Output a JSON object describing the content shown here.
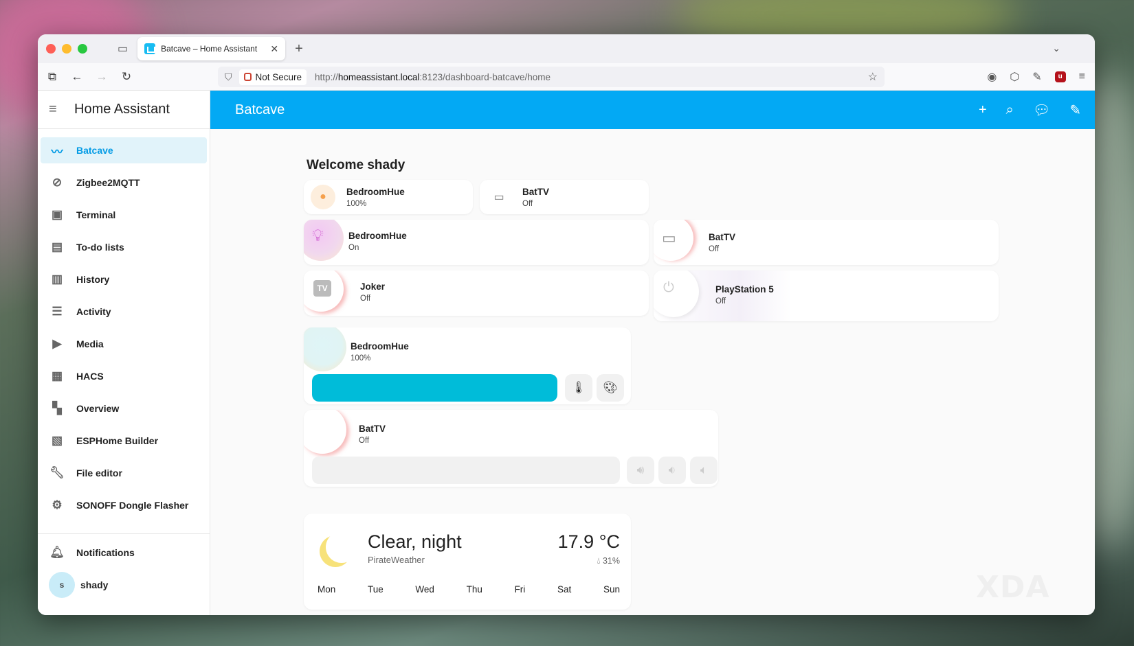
{
  "browser": {
    "tab_title": "Batcave – Home Assistant",
    "address_not_secure": "Not Secure",
    "url_prefix": "http://",
    "url_host": "homeassistant.local",
    "url_path": ":8123/dashboard-batcave/home"
  },
  "sidebar": {
    "app_name": "Home Assistant",
    "items": [
      {
        "label": "Batcave",
        "icon": "bat-icon"
      },
      {
        "label": "Zigbee2MQTT",
        "icon": "zigbee-icon"
      },
      {
        "label": "Terminal",
        "icon": "terminal-icon"
      },
      {
        "label": "To-do lists",
        "icon": "clipboard-list-icon"
      },
      {
        "label": "History",
        "icon": "chart-bar-icon"
      },
      {
        "label": "Activity",
        "icon": "format-list-icon"
      },
      {
        "label": "Media",
        "icon": "play-box-icon"
      },
      {
        "label": "HACS",
        "icon": "hacs-store-icon"
      },
      {
        "label": "Overview",
        "icon": "view-dashboard-icon"
      },
      {
        "label": "ESPHome Builder",
        "icon": "chip-icon"
      },
      {
        "label": "File editor",
        "icon": "wrench-icon"
      },
      {
        "label": "SONOFF Dongle Flasher",
        "icon": "cog-chip-icon"
      }
    ],
    "notifications": "Notifications",
    "user": {
      "initial": "s",
      "name": "shady"
    }
  },
  "header": {
    "title": "Batcave"
  },
  "dashboard": {
    "welcome": "Welcome shady",
    "tiles": [
      {
        "name": "BedroomHue",
        "state": "100%"
      },
      {
        "name": "BatTV",
        "state": "Off"
      }
    ],
    "mushroom": [
      {
        "name": "BedroomHue",
        "state": "On"
      },
      {
        "name": "BatTV",
        "state": "Off"
      },
      {
        "name": "Joker",
        "state": "Off"
      },
      {
        "name": "PlayStation 5",
        "state": "Off"
      }
    ],
    "light_card": {
      "name": "BedroomHue",
      "state": "100%",
      "brightness": 1.0
    },
    "media_card": {
      "name": "BatTV",
      "state": "Off"
    },
    "weather": {
      "condition": "Clear, night",
      "provider": "PirateWeather",
      "temperature": "17.9 °C",
      "humidity": "31%",
      "days": [
        "Mon",
        "Tue",
        "Wed",
        "Thu",
        "Fri",
        "Sat",
        "Sun"
      ]
    }
  },
  "colors": {
    "accent": "#03a9f4",
    "light_bar": "#00bcd9",
    "light_on": "#c542c7"
  },
  "watermark": "XDA"
}
